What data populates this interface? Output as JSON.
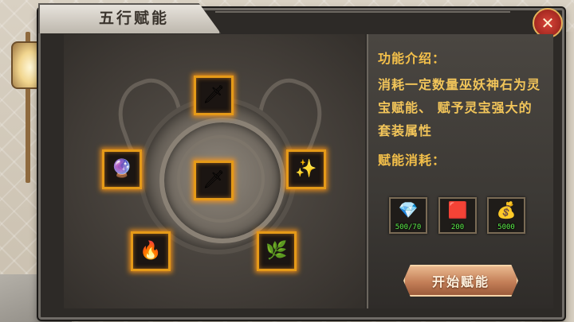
{
  "window": {
    "title": "五行赋能",
    "close_label": "✕"
  },
  "slots": [
    {
      "id": "top",
      "icon": "flame-sword-icon",
      "glyph": "🗡"
    },
    {
      "id": "center",
      "icon": "flame-sword-icon",
      "glyph": "🗡"
    },
    {
      "id": "left",
      "icon": "crystal-orb-icon",
      "glyph": "🔮"
    },
    {
      "id": "right",
      "icon": "spirit-wing-icon",
      "glyph": "✨"
    },
    {
      "id": "bottom-left",
      "icon": "fire-wheel-icon",
      "glyph": "🔥"
    },
    {
      "id": "bottom-right",
      "icon": "green-blade-icon",
      "glyph": "🌿"
    }
  ],
  "info": {
    "intro_title": "功能介绍：",
    "intro_text": "消耗一定数量巫妖神石为灵宝赋能、 赋予灵宝强大的套装属性",
    "cost_title": "赋能消耗："
  },
  "costs": [
    {
      "icon": "crystal-ore-icon",
      "glyph": "💎",
      "quantity": "500/70"
    },
    {
      "icon": "red-ore-icon",
      "glyph": "🟥",
      "quantity": "200"
    },
    {
      "icon": "gold-pouch-icon",
      "glyph": "💰",
      "quantity": "5000"
    }
  ],
  "actions": {
    "start_label": "开始赋能"
  },
  "colors": {
    "accent_gold": "#f4c04a",
    "slot_glow": "#e59a18",
    "qty_green": "#5cf04a",
    "button": "#c47f58"
  }
}
